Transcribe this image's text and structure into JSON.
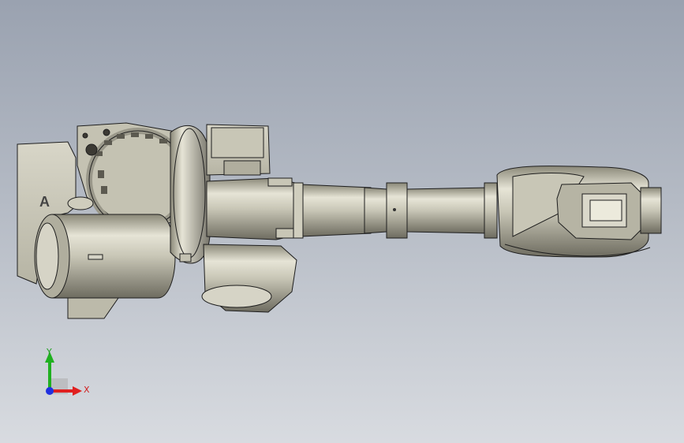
{
  "viewport": {
    "background_top": "#9aa2b0",
    "background_bottom": "#d8dbe0"
  },
  "model": {
    "base_lettering": "A",
    "part_color_light": "#d6d4c6",
    "part_color_mid": "#b8b6a6",
    "part_color_dark": "#7c7a6c",
    "edge_color": "#1e1e1e"
  },
  "triad": {
    "x_label": "X",
    "y_label": "Y",
    "x_color": "#e02020",
    "y_color": "#20b020",
    "z_color": "#2030e0"
  }
}
